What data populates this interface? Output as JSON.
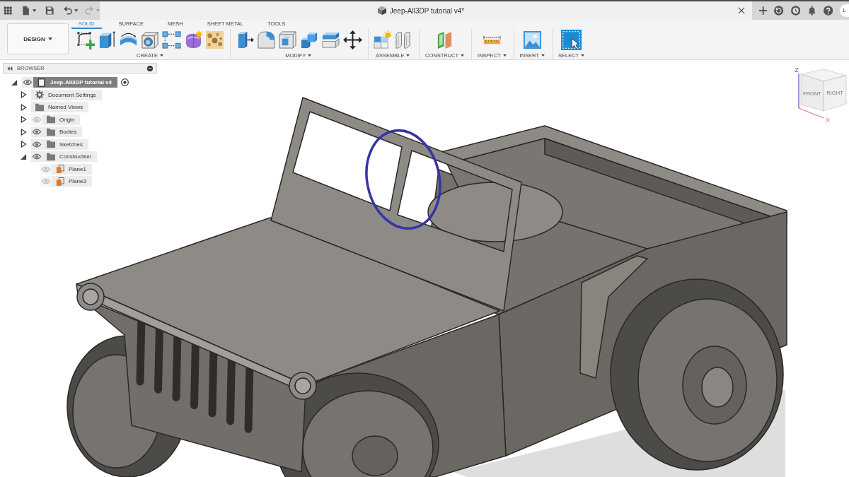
{
  "title_bar": {
    "document_title": "Jeep-All3DP tutorial v4*",
    "user_initial": "L"
  },
  "toolbar": {
    "workspace": "DESIGN",
    "tabs": [
      {
        "label": "SOLID",
        "selected": true
      },
      {
        "label": "SURFACE",
        "selected": false
      },
      {
        "label": "MESH",
        "selected": false
      },
      {
        "label": "SHEET METAL",
        "selected": false
      },
      {
        "label": "TOOLS",
        "selected": false
      }
    ],
    "groups": [
      {
        "label": "CREATE"
      },
      {
        "label": "MODIFY"
      },
      {
        "label": "ASSEMBLE"
      },
      {
        "label": "CONSTRUCT"
      },
      {
        "label": "INSPECT"
      },
      {
        "label": "INSERT"
      },
      {
        "label": "SELECT"
      }
    ]
  },
  "browser": {
    "title": "BROWSER",
    "tree": [
      {
        "label": "Jeep-All3DP tutorial v4",
        "kind": "document",
        "selected": true,
        "expanded": true,
        "visible": true,
        "children": [
          {
            "label": "Document Settings",
            "kind": "settings",
            "selected": false,
            "expanded": false
          },
          {
            "label": "Named Views",
            "kind": "folder",
            "selected": false,
            "expanded": false
          },
          {
            "label": "Origin",
            "kind": "folder",
            "selected": false,
            "expanded": false,
            "visible": false
          },
          {
            "label": "Bodies",
            "kind": "folder",
            "selected": false,
            "expanded": false,
            "visible": true
          },
          {
            "label": "Sketches",
            "kind": "folder",
            "selected": false,
            "expanded": false,
            "visible": true
          },
          {
            "label": "Construction",
            "kind": "folder",
            "selected": false,
            "expanded": true,
            "visible": true,
            "children": [
              {
                "label": "Plane1",
                "kind": "plane",
                "selected": false,
                "visible": false
              },
              {
                "label": "Plane3",
                "kind": "plane",
                "selected": false,
                "visible": false
              }
            ]
          }
        ]
      }
    ]
  },
  "view_cube": {
    "face_labels": [
      "FRONT",
      "RIGHT"
    ],
    "axis_labels": [
      "Z",
      "X"
    ]
  }
}
